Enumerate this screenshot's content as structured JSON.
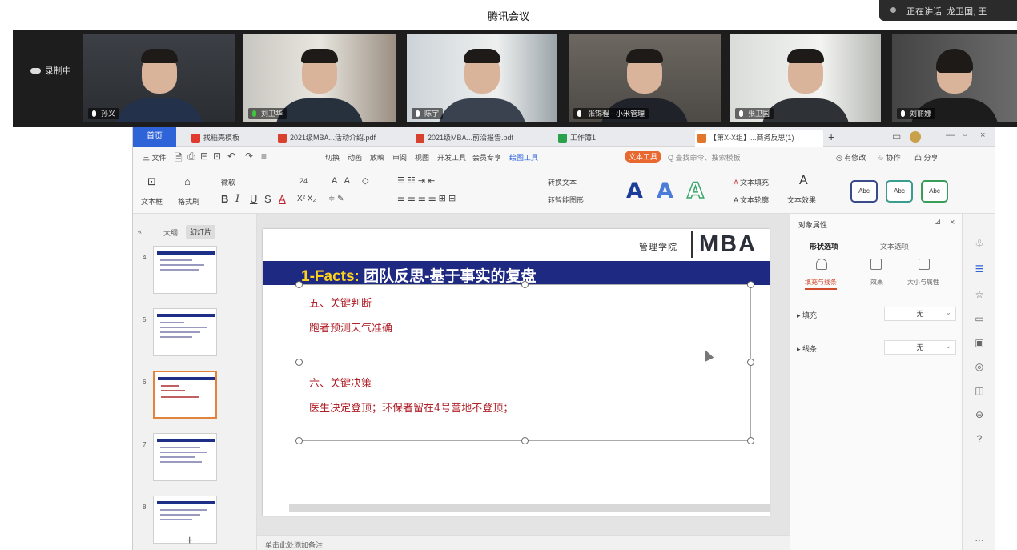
{
  "meeting": {
    "title": "腾讯会议",
    "toast": "正在讲话: 龙卫国; 王",
    "recording": "录制中",
    "participants": [
      {
        "name": "孙义"
      },
      {
        "name": "刘卫华"
      },
      {
        "name": "陈宇"
      },
      {
        "name": "张锦程 - 小米管理"
      },
      {
        "name": "张卫国"
      },
      {
        "name": "刘丽娜"
      }
    ]
  },
  "wps": {
    "home_tab": "首页",
    "tabs": [
      {
        "label": "找稻壳模板"
      },
      {
        "label": "2021级MBA...活动介绍.pdf"
      },
      {
        "label": "2021级MBA...前沿报告.pdf"
      },
      {
        "label": "工作簿1"
      },
      {
        "label": "【第X-X组】...商务反思(1)"
      }
    ],
    "menu": {
      "file": "三 文件",
      "items": [
        "切换",
        "动画",
        "放映",
        "审阅",
        "视图",
        "开发工具",
        "会员专享",
        "绘图工具"
      ],
      "active": "文本工具",
      "search": "Q 查找命令、搜索模板",
      "right": [
        "◎ 有修改",
        "♧ 协作",
        "凸 分享"
      ]
    },
    "ribbon": {
      "textbox": "文本框",
      "format_painter": "格式刷",
      "font_name": "微软",
      "font_size": "24",
      "bold": "B",
      "italic": "I",
      "underline": "U",
      "strike": "S",
      "font_color": "A",
      "convert": "转换文本",
      "smartart": "转智能图形",
      "styles": [
        "A",
        "A",
        "A"
      ],
      "fill": "文本填充",
      "outline": "文本轮廓",
      "effect": "文本效果",
      "quick_styles": [
        "Abc",
        "Abc",
        "Abc"
      ]
    },
    "outline": {
      "tab_outline": "大纲",
      "tab_slides": "幻灯片",
      "thumbs": [
        "4",
        "5",
        "6",
        "7",
        "8"
      ],
      "add": "+"
    },
    "slide": {
      "logo_cn": "管理学院",
      "logo_mba": "MBA",
      "title_lead": "1-Facts:",
      "title_rest": "团队反思-基于事实的复盘",
      "lines": [
        "五、关键判断",
        "跑者预测天气准确",
        "六、关键决策",
        "医生决定登顶；环保者留在4号营地不登顶；"
      ]
    },
    "status": "单击此处添加备注",
    "props": {
      "title": "对象属性",
      "tab1": "形状选项",
      "tab2": "文本选项",
      "sub": [
        "填充与线条",
        "效果",
        "大小与属性"
      ],
      "fill_label": "填充",
      "fill_value": "无",
      "line_label": "线条",
      "line_value": "无"
    }
  }
}
